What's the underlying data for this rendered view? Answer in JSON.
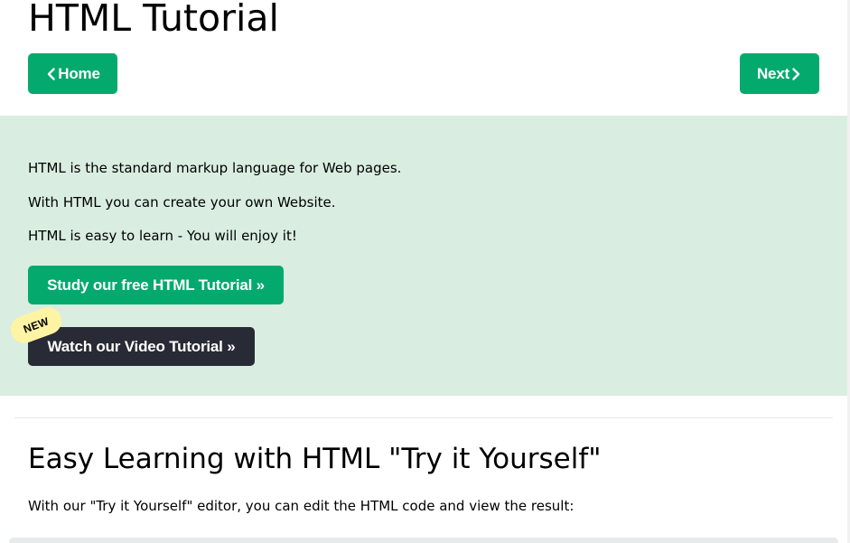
{
  "header": {
    "title": "HTML Tutorial",
    "home_label": "Home",
    "next_label": "Next"
  },
  "hero": {
    "line1": "HTML is the standard markup language for Web pages.",
    "line2": "With HTML you can create your own Website.",
    "line3": "HTML is easy to learn - You will enjoy it!",
    "study_button": "Study our free HTML Tutorial »",
    "video_button": "Watch our Video Tutorial »",
    "new_badge": "NEW"
  },
  "section": {
    "title": "Easy Learning with HTML \"Try it Yourself\"",
    "text": "With our \"Try it Yourself\" editor, you can edit the HTML code and view the result:"
  },
  "colors": {
    "accent_green": "#04aa6d",
    "dark_button": "#282a35",
    "hero_background": "#d9eee1",
    "badge_yellow": "#fff4a3"
  },
  "icons": {
    "home_icon": "chevron-left-icon",
    "next_icon": "chevron-right-icon"
  }
}
